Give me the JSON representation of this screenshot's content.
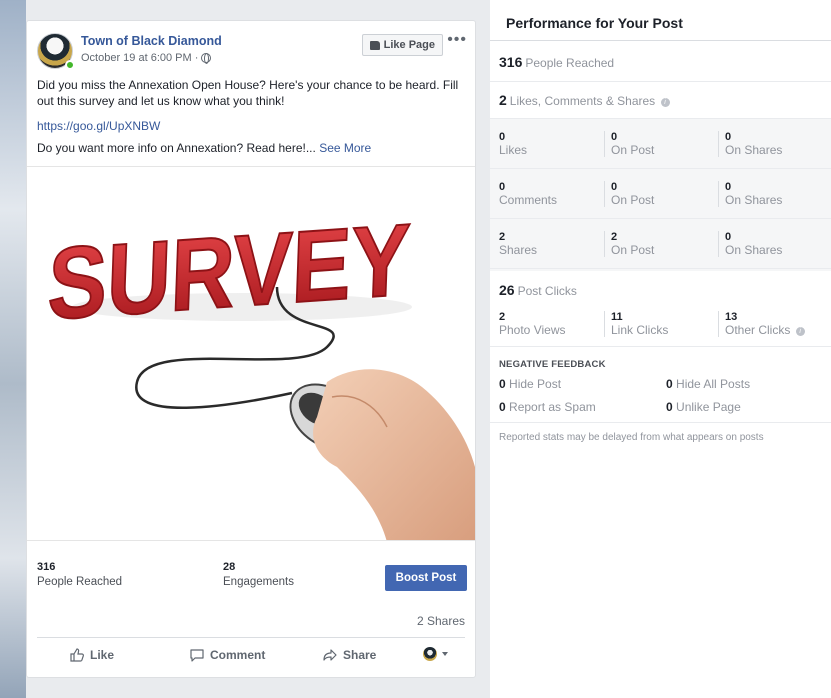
{
  "post": {
    "page_name": "Town of Black Diamond",
    "timestamp": "October 19 at 6:00 PM ·",
    "like_page_label": "Like Page",
    "more_label": "•••",
    "text": "Did you miss the Annexation Open House? Here's your chance to be heard. Fill out this survey and let us know what you think!",
    "link": "https://goo.gl/UpXNBW",
    "more_text": "Do you want more info on Annexation? Read here!...",
    "see_more": "See More",
    "image_word": "SURVEY",
    "stats": {
      "reached_value": "316",
      "reached_label": "People Reached",
      "engagements_value": "28",
      "engagements_label": "Engagements"
    },
    "boost_label": "Boost Post",
    "shares_count": "2 Shares",
    "actions": {
      "like": "Like",
      "comment": "Comment",
      "share": "Share"
    }
  },
  "performance": {
    "title": "Performance for Your Post",
    "reached_value": "316",
    "reached_label": "People Reached",
    "engagement_value": "2",
    "engagement_label": "Likes, Comments & Shares",
    "likes": {
      "total": "0",
      "total_label": "Likes",
      "on_post": "0",
      "on_post_label": "On Post",
      "on_shares": "0",
      "on_shares_label": "On Shares"
    },
    "comments": {
      "total": "0",
      "total_label": "Comments",
      "on_post": "0",
      "on_post_label": "On Post",
      "on_shares": "0",
      "on_shares_label": "On Shares"
    },
    "shares": {
      "total": "2",
      "total_label": "Shares",
      "on_post": "2",
      "on_post_label": "On Post",
      "on_shares": "0",
      "on_shares_label": "On Shares"
    },
    "clicks_value": "26",
    "clicks_label": "Post Clicks",
    "photo_views": "2",
    "photo_views_label": "Photo Views",
    "link_clicks": "11",
    "link_clicks_label": "Link Clicks",
    "other_clicks": "13",
    "other_clicks_label": "Other Clicks",
    "negative_title": "NEGATIVE FEEDBACK",
    "hide_post": "0",
    "hide_post_label": "Hide Post",
    "hide_all": "0",
    "hide_all_label": "Hide All Posts",
    "spam": "0",
    "spam_label": "Report as Spam",
    "unlike": "0",
    "unlike_label": "Unlike Page",
    "disclaimer": "Reported stats may be delayed from what appears on posts"
  }
}
